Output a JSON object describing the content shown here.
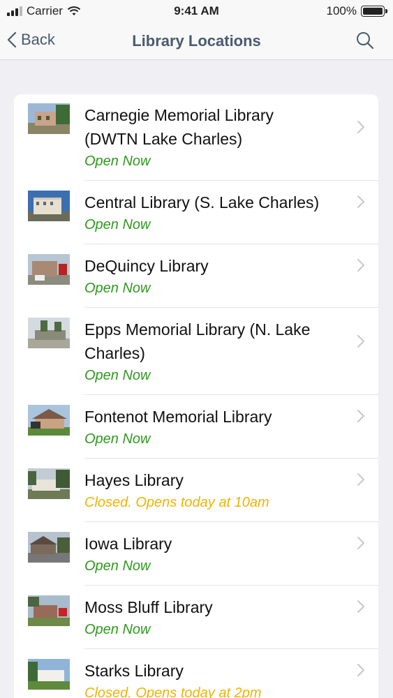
{
  "status_bar": {
    "carrier": "Carrier",
    "time": "9:41 AM",
    "battery": "100%"
  },
  "nav": {
    "back_label": "Back",
    "title": "Library Locations"
  },
  "colors": {
    "open": "#2e9a1d",
    "closed": "#f0b400",
    "nav_tint": "#4a5a70"
  },
  "locations": [
    {
      "name_line1": "Carnegie Memorial Library",
      "name_line2": "(DWTN Lake Charles)",
      "status": "Open Now",
      "state": "open"
    },
    {
      "name_line1": "Central Library (S. Lake Charles)",
      "name_line2": "",
      "status": "Open Now",
      "state": "open"
    },
    {
      "name_line1": "DeQuincy Library",
      "name_line2": "",
      "status": "Open Now",
      "state": "open"
    },
    {
      "name_line1": "Epps Memorial Library (N. Lake",
      "name_line2": "Charles)",
      "status": "Open Now",
      "state": "open"
    },
    {
      "name_line1": "Fontenot Memorial Library",
      "name_line2": "",
      "status": "Open Now",
      "state": "open"
    },
    {
      "name_line1": "Hayes Library",
      "name_line2": "",
      "status": "Closed. Opens today at 10am",
      "state": "closed"
    },
    {
      "name_line1": "Iowa Library",
      "name_line2": "",
      "status": "Open Now",
      "state": "open"
    },
    {
      "name_line1": "Moss Bluff Library",
      "name_line2": "",
      "status": "Open Now",
      "state": "open"
    },
    {
      "name_line1": "Starks Library",
      "name_line2": "",
      "status": "Closed. Opens today at 2pm",
      "state": "closed"
    }
  ]
}
